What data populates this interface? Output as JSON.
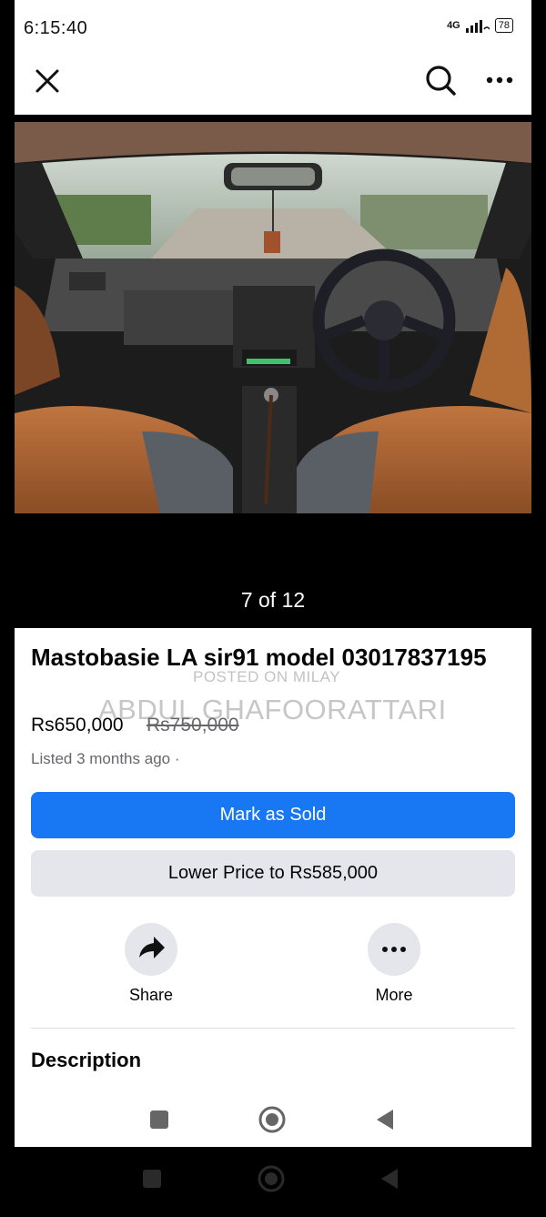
{
  "status": {
    "time": "6:15:40",
    "network": "4G",
    "battery": "78"
  },
  "top_bar": {
    "close_icon": "close-icon",
    "search_icon": "search-icon",
    "more_icon": "more-horizontal-icon"
  },
  "viewer": {
    "counter": "7 of 12"
  },
  "listing": {
    "title": "Mastobasie LA sir91 model 03017837195",
    "price_current": "Rs650,000",
    "price_original": "Rs750,000",
    "listed": "Listed 3 months ago ·",
    "watermark_line1": "POSTED ON MILAY",
    "watermark_line2": "ABDUL GHAFOORATTARI"
  },
  "actions": {
    "mark_sold": "Mark as Sold",
    "lower_price": "Lower Price to Rs585,000",
    "share": "Share",
    "more": "More"
  },
  "description": {
    "heading": "Description"
  },
  "colors": {
    "accent": "#1877f2",
    "secondary_button": "#e4e6eb"
  }
}
